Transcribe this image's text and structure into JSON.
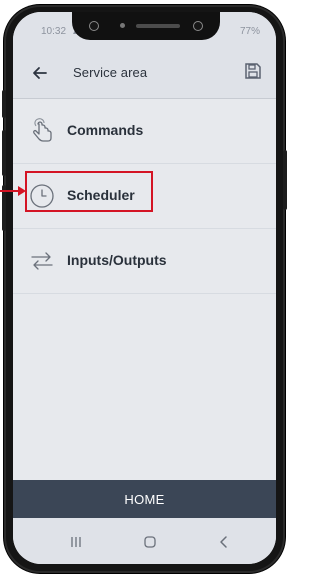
{
  "status_bar": {
    "time": "10:32",
    "extra": "▲",
    "battery": "77%"
  },
  "header": {
    "title": "Service area"
  },
  "menu": {
    "items": [
      {
        "label": "Commands",
        "icon": "hand-tap-icon"
      },
      {
        "label": "Scheduler",
        "icon": "clock-icon"
      },
      {
        "label": "Inputs/Outputs",
        "icon": "swap-arrows-icon"
      }
    ]
  },
  "bottom": {
    "home_label": "HOME"
  },
  "colors": {
    "screen_bg": "#e7e9ed",
    "header_bg": "#dfe2e8",
    "home_bar_bg": "#3b4656",
    "highlight": "#d41424"
  }
}
